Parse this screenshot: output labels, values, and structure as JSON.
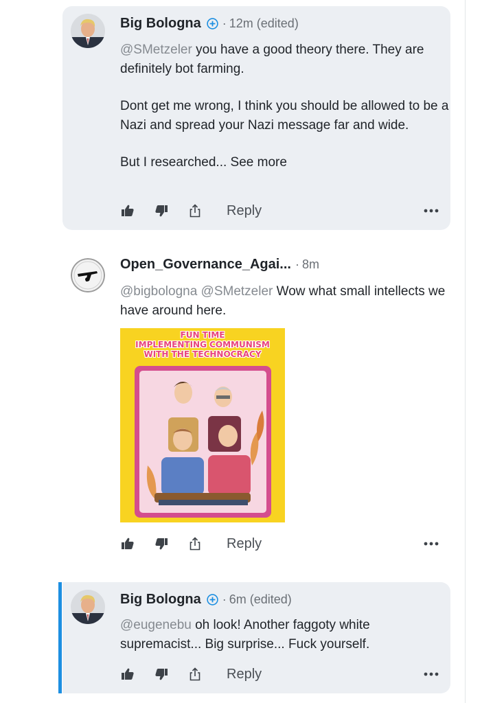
{
  "comments": [
    {
      "username": "Big Bologna",
      "time": "12m (edited)",
      "paragraphs": [
        {
          "mention": "@SMetzeler",
          "text": " you have a good theory there. They are definitely bot farming."
        },
        {
          "mention": "",
          "text": "Dont get me wrong, I think you should be allowed to be a Nazi and spread your Nazi message far and wide."
        },
        {
          "mention": "",
          "text": "But I researched...",
          "see_more": " See more"
        }
      ],
      "reply_label": "Reply"
    },
    {
      "username": "Open_Governance_Agai...",
      "time": "8m",
      "mention": "@bigbologna @SMetzeler",
      "text": " Wow what small intellects we have around here.",
      "image": {
        "title_lines": [
          "FUN TIME",
          "IMPLEMENTING COMMUNISM",
          "WITH THE TECHNOCRACY"
        ],
        "background": "#f8d321",
        "frame_color": "#d44d8e"
      },
      "reply_label": "Reply"
    },
    {
      "username": "Big Bologna",
      "time": "6m (edited)",
      "mention": "@eugenebu",
      "text": " oh look! Another faggoty white supremacist... Big surprise... Fuck yourself.",
      "reply_label": "Reply"
    }
  ],
  "icons": {
    "like": "thumbs-up-icon",
    "dislike": "thumbs-down-icon",
    "share": "share-icon",
    "more": "more-options-icon",
    "follow": "plus-circle-icon"
  },
  "colors": {
    "accent": "#1d8fe1",
    "bubble": "#eceff3",
    "mention": "#858a90"
  }
}
